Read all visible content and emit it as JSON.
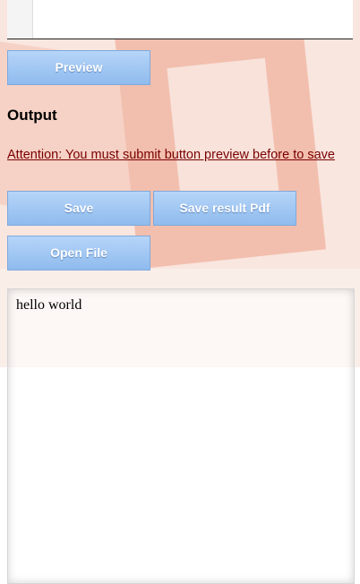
{
  "buttons": {
    "preview": "Preview",
    "save": "Save",
    "save_pdf": "Save result Pdf",
    "open_file": "Open File"
  },
  "output": {
    "heading": "Output",
    "attention": "Attention: You must submit button preview before to save",
    "result_text": "hello world"
  },
  "colors": {
    "button_top": "#b6d5f8",
    "button_bottom": "#8fbbee",
    "attention_link": "#7a0000"
  }
}
